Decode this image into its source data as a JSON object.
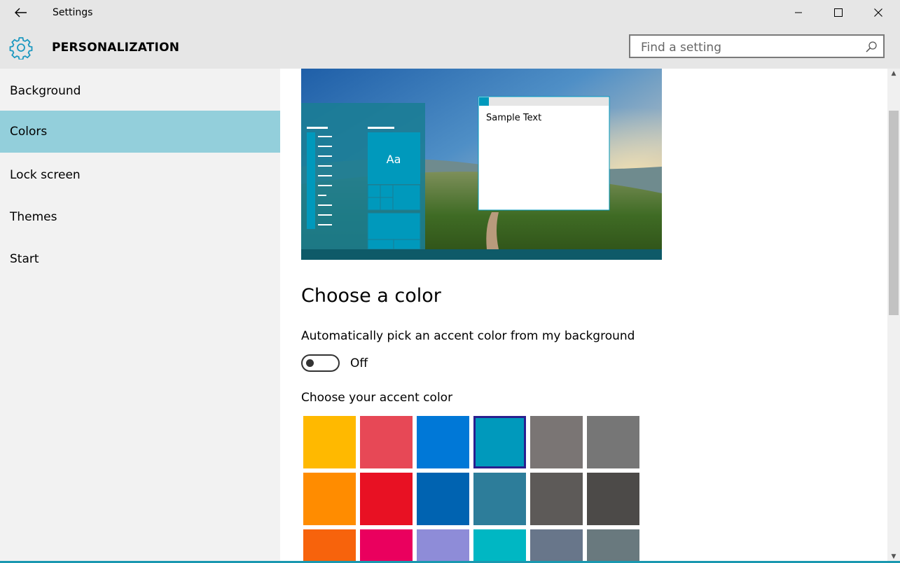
{
  "window": {
    "title": "Settings",
    "back_icon": "back-arrow-icon",
    "minimize_icon": "minimize-icon",
    "maximize_icon": "maximize-icon",
    "close_icon": "close-icon"
  },
  "header": {
    "icon": "gear-icon",
    "title": "PERSONALIZATION",
    "search_placeholder": "Find a setting",
    "search_icon": "search-icon"
  },
  "sidebar": {
    "items": [
      {
        "label": "Background",
        "active": false
      },
      {
        "label": "Colors",
        "active": true
      },
      {
        "label": "Lock screen",
        "active": false
      },
      {
        "label": "Themes",
        "active": false
      },
      {
        "label": "Start",
        "active": false
      }
    ]
  },
  "preview": {
    "tile_text": "Aa",
    "sample_text": "Sample Text"
  },
  "colors": {
    "section_title": "Choose a color",
    "auto_pick_label": "Automatically pick an accent color from my background",
    "toggle_state": "Off",
    "accent_label": "Choose your accent color",
    "selected_index": 3,
    "swatches": [
      "#ffb900",
      "#e74856",
      "#0078d7",
      "#0099bc",
      "#7a7574",
      "#767676",
      "#ff8c00",
      "#e81123",
      "#0063b1",
      "#2d7d9a",
      "#5d5a58",
      "#4c4a48",
      "#f7630c",
      "#ea005e",
      "#8e8cd8",
      "#00b7c3",
      "#68768a",
      "#69797e"
    ]
  },
  "accent_color": "#0099bc"
}
